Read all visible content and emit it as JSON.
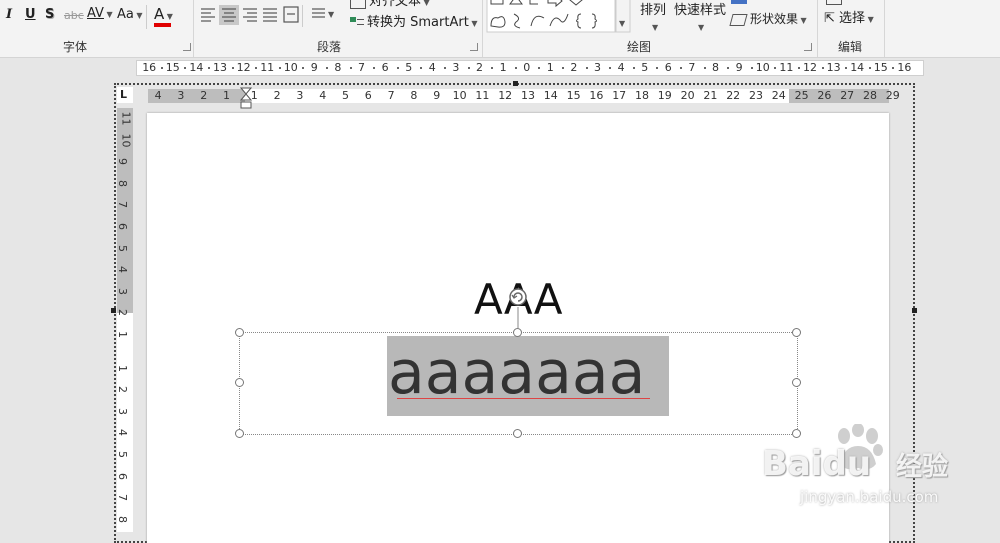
{
  "ribbon": {
    "font_group": {
      "label": "字体",
      "italic": "I",
      "underline": "U",
      "shadow": "S",
      "strike": "abc",
      "spacing": "AV",
      "case": "Aa",
      "font_color": "A"
    },
    "paragraph_group": {
      "label": "段落",
      "align_text": "对齐文本",
      "convert_smartart": "转换为 SmartArt"
    },
    "drawing_group": {
      "label": "绘图",
      "arrange": "排列",
      "quick_styles": "快速样式",
      "shape_effects": "形状效果"
    },
    "editing_group": {
      "label": "编辑",
      "select": "选择"
    }
  },
  "ruler_top_labels": [
    "16",
    "15",
    "14",
    "13",
    "12",
    "11",
    "10",
    "9",
    "8",
    "7",
    "6",
    "5",
    "4",
    "3",
    "2",
    "1",
    "0",
    "1",
    "2",
    "3",
    "4",
    "5",
    "6",
    "7",
    "8",
    "9",
    "10",
    "11",
    "12",
    "13",
    "14",
    "15",
    "16"
  ],
  "ruler_indent_labels": [
    "4",
    "3",
    "2",
    "1",
    "1",
    "2",
    "3",
    "4",
    "5",
    "6",
    "7",
    "8",
    "9",
    "10",
    "11",
    "12",
    "13",
    "14",
    "15",
    "16",
    "17",
    "18",
    "19",
    "20",
    "21",
    "22",
    "23",
    "24",
    "25",
    "26",
    "27",
    "28",
    "29"
  ],
  "ruler_tab_selector": "L",
  "ruler_vertical_labels": [
    "11",
    "10",
    "9",
    "8",
    "7",
    "6",
    "5",
    "4",
    "3",
    "2",
    "1",
    "1",
    "2",
    "3",
    "4",
    "5",
    "6",
    "7",
    "8"
  ],
  "slide": {
    "title_text": "AAA",
    "body_text": "aaaaaaa"
  },
  "watermark": {
    "brand": "Baidu",
    "brand_cn": "经验",
    "url": "jingyan.baidu.com"
  },
  "colors": {
    "accent_font_color": "#e00000",
    "selection_highlight": "#b8b8b8",
    "ribbon_bg": "#f3f3f3"
  }
}
